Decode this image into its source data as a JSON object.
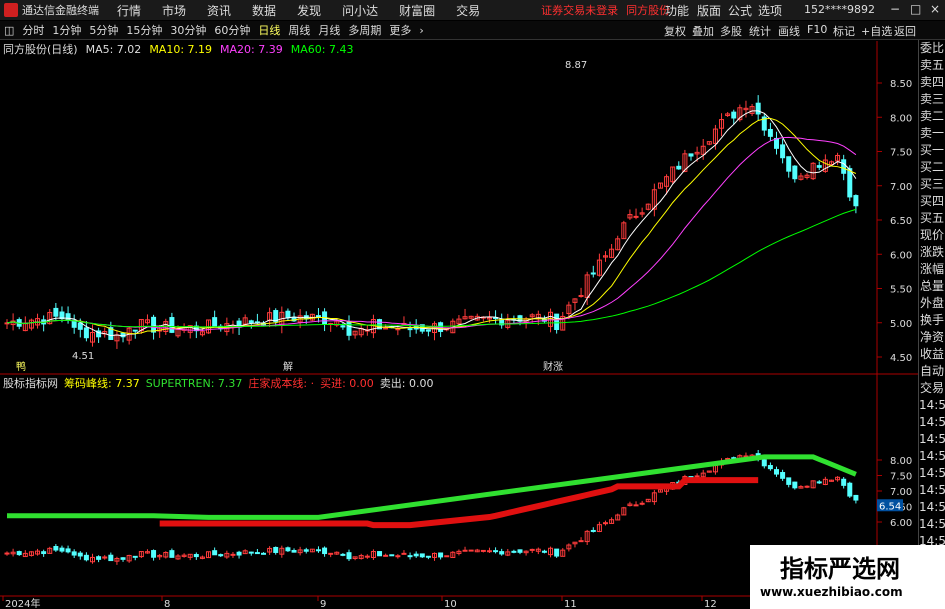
{
  "titlebar": {
    "app_title": "通达信金融终端",
    "menus": [
      "行情",
      "市场",
      "资讯",
      "数据",
      "发现",
      "问小达",
      "财富圈",
      "交易"
    ],
    "alert": "证券交易未登录",
    "stock_name_alert": "同方股份",
    "right_menus": [
      "功能",
      "版面",
      "公式",
      "选项"
    ],
    "user": "152****9892"
  },
  "toolbar": {
    "periods": [
      "分时",
      "1分钟",
      "5分钟",
      "15分钟",
      "30分钟",
      "60分钟",
      "日线",
      "周线",
      "月线",
      "多周期",
      "更多"
    ],
    "active": "日线",
    "right": [
      "复权",
      "叠加",
      "多股",
      "统计",
      "画线",
      "F10",
      "标记",
      "+自选",
      "返回"
    ]
  },
  "main_info": {
    "stock": "同方股份(日线)",
    "ma5": "MA5: 7.02",
    "ma10": "MA10: 7.19",
    "ma20": "MA20: 7.39",
    "ma60": "MA60: 7.43"
  },
  "sub_info": {
    "indicator": "股标指标网",
    "chip": "筹码峰线: 7.37",
    "supertrend": "SUPERTREN: 7.37",
    "cost": "庄家成本线: ·",
    "buy": "买进: 0.00",
    "sell": "卖出: 0.00"
  },
  "side_panel": [
    "委比",
    "卖五",
    "卖四",
    "卖三",
    "卖二",
    "卖一",
    "买一",
    "买二",
    "买三",
    "买四",
    "买五",
    "现价",
    "涨跌",
    "涨幅",
    "总量",
    "外盘",
    "换手",
    "净资",
    "收益",
    "自动",
    "交易",
    "14:56",
    "14:56",
    "14:56",
    "14:56",
    "14:56",
    "14:56",
    "14:56",
    "14:56",
    "14:56",
    "14:56"
  ],
  "price_axis": [
    "8.50",
    "8.00",
    "7.50",
    "7.00",
    "6.50",
    "6.00",
    "5.50",
    "5.00",
    "4.50"
  ],
  "sub_axis": [
    "8.00",
    "7.50",
    "7.00",
    "6.50",
    "6.00"
  ],
  "sub_current": "6.54",
  "markers": {
    "high": "8.87",
    "low": "4.51",
    "tag1": "鸭",
    "tag2": "解",
    "tag3": "财涨"
  },
  "date_axis": [
    "2024年",
    "8",
    "9",
    "10",
    "11",
    "12"
  ],
  "watermark": {
    "title": "指标严选网",
    "url": "www.xuezhibiao.com"
  },
  "colors": {
    "up": "#ff3c3c",
    "down": "#54ffff",
    "ma5": "#ffffff",
    "ma10": "#ffff00",
    "ma20": "#ff40ff",
    "ma60": "#00ff00",
    "support": "#e01010",
    "resist": "#30e030"
  }
}
